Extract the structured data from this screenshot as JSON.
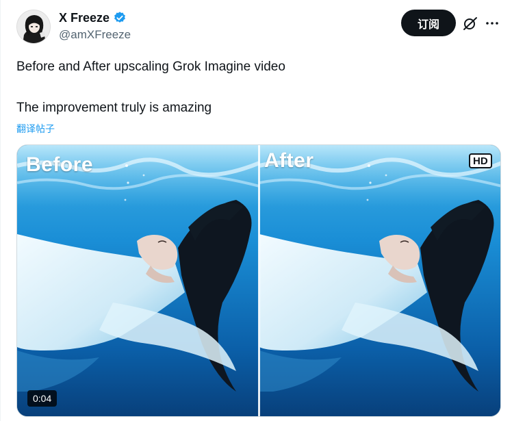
{
  "author": {
    "display_name": "X Freeze",
    "handle": "@amXFreeze",
    "verified": true,
    "verified_color": "#1d9bf0",
    "avatar_icon": "anime-character-avatar"
  },
  "header": {
    "subscribe_label": "订阅",
    "grok_icon": "grok-icon",
    "more_icon": "more-dots-icon"
  },
  "tweet": {
    "line1": "Before and After upscaling Grok Imagine video",
    "line2": "The improvement truly is amazing",
    "translate_label": "翻译帖子",
    "link_color": "#1d9bf0"
  },
  "media": {
    "before_label": "Before",
    "after_label": "After",
    "hd_badge": "HD",
    "duration": "0:04"
  }
}
